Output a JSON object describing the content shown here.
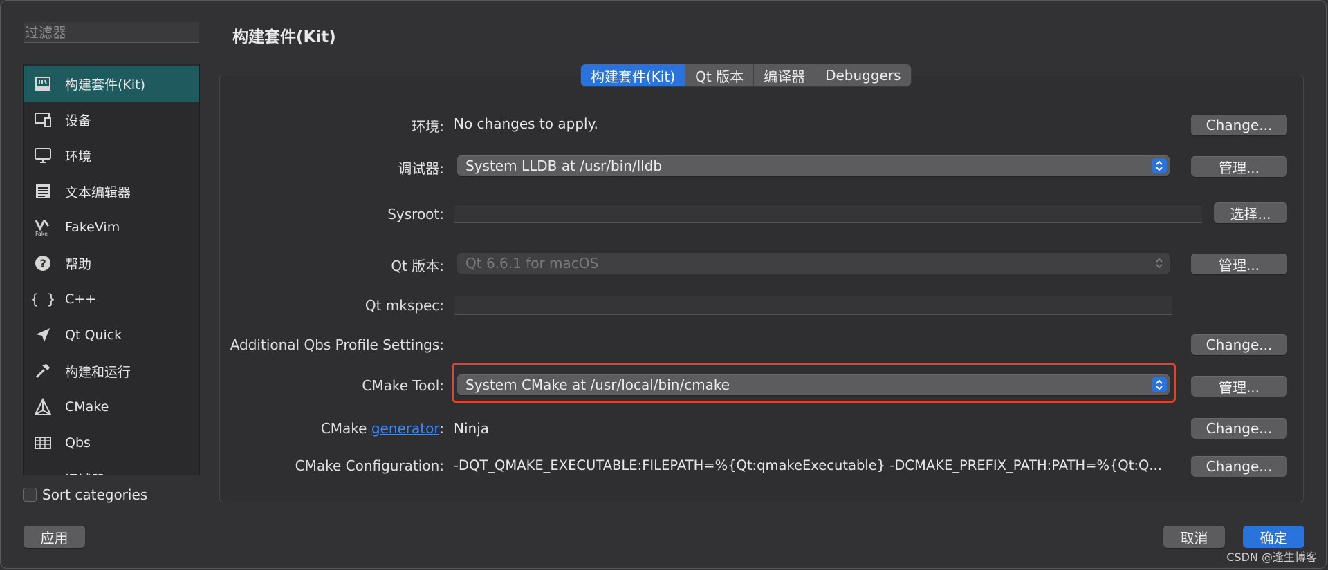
{
  "filter": {
    "placeholder": "过滤器"
  },
  "sidebar": {
    "items": [
      {
        "label": "构建套件(Kit)",
        "icon": "kit-icon"
      },
      {
        "label": "设备",
        "icon": "device-icon"
      },
      {
        "label": "环境",
        "icon": "monitor-icon"
      },
      {
        "label": "文本编辑器",
        "icon": "text-editor-icon"
      },
      {
        "label": "FakeVim",
        "icon": "fakevim-icon"
      },
      {
        "label": "帮助",
        "icon": "help-icon"
      },
      {
        "label": "C++",
        "icon": "braces-icon"
      },
      {
        "label": "Qt Quick",
        "icon": "qt-quick-icon"
      },
      {
        "label": "构建和运行",
        "icon": "hammer-icon"
      },
      {
        "label": "CMake",
        "icon": "cmake-icon"
      },
      {
        "label": "Qbs",
        "icon": "qbs-icon"
      },
      {
        "label": "调试器",
        "icon": "debugger-icon"
      }
    ],
    "sort_label": "Sort categories"
  },
  "title": "构建套件(Kit)",
  "tabs": [
    "构建套件(Kit)",
    "Qt 版本",
    "编译器",
    "Debuggers"
  ],
  "rows": {
    "env": {
      "label": "环境:",
      "value": "No changes to apply.",
      "button": "Change..."
    },
    "debugger": {
      "label": "调试器:",
      "value": "System LLDB at /usr/bin/lldb",
      "button": "管理..."
    },
    "sysroot": {
      "label": "Sysroot:",
      "button": "选择..."
    },
    "qt_version": {
      "label": "Qt 版本:",
      "value": "Qt 6.6.1 for macOS",
      "button": "管理..."
    },
    "mkspec": {
      "label": "Qt mkspec:"
    },
    "qbs": {
      "label": "Additional Qbs Profile Settings:",
      "button": "Change..."
    },
    "cmake_tool": {
      "label": "CMake Tool:",
      "value": "System CMake at /usr/local/bin/cmake",
      "button": "管理..."
    },
    "cmake_generator": {
      "label_prefix": "CMake ",
      "label_link": "generator",
      "label_suffix": ":",
      "value": "Ninja",
      "button": "Change..."
    },
    "cmake_config": {
      "label": "CMake Configuration:",
      "value": "-DQT_QMAKE_EXECUTABLE:FILEPATH=%{Qt:qmakeExecutable} -DCMAKE_PREFIX_PATH:PATH=%{Qt:Q...",
      "button": "Change..."
    }
  },
  "footer": {
    "apply": "应用",
    "cancel": "取消",
    "ok": "确定"
  },
  "watermark": "CSDN @逢生博客",
  "colors": {
    "accent": "#2a72dc",
    "active_sidebar": "#1f5a5e",
    "highlight": "#e0452b"
  }
}
